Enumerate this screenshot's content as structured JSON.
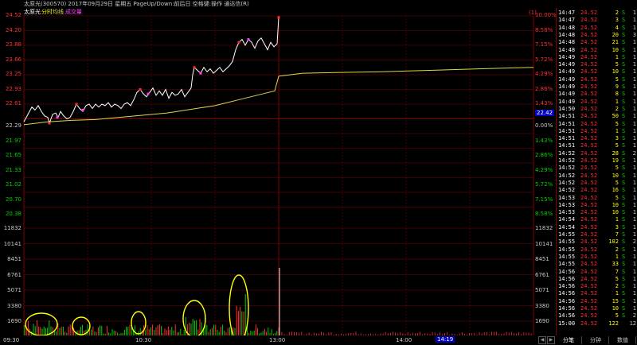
{
  "title": "太原光(300570) 2017年09月29日 星期五 PageUp/Down:前后日 空格键:操作 通达信(R)",
  "tabs": [
    "太原光",
    "分时",
    "均线",
    "成交量"
  ],
  "corner_label": "(1)",
  "colors": {
    "up": "#ff3030",
    "down": "#00d000",
    "grid": "#800000",
    "price_line": "#ffffff",
    "avg_line": "#d8d850",
    "highlight": "#ffff00",
    "marker": "#ff40ff",
    "neutral": "#c8c8c8"
  },
  "price_axis": {
    "left_up": [
      "24.52",
      "24.20",
      "23.88",
      "23.66",
      "23.25",
      "22.93",
      "22.61"
    ],
    "base": "22.29",
    "left_down": [
      "21.97",
      "21.65",
      "21.33",
      "21.02",
      "20.70",
      "20.38"
    ],
    "right_up": [
      "10.00%",
      "8.58%",
      "7.15%",
      "5.72%",
      "4.29%",
      "2.86%",
      "1.43%"
    ],
    "base_pct": "0.00%",
    "right_down": [
      "1.43%",
      "2.86%",
      "4.29%",
      "5.72%",
      "7.15%",
      "8.58%"
    ],
    "current_price_tag": "22.42"
  },
  "volume_axis": [
    "11832",
    "10141",
    "8451",
    "6761",
    "5071",
    "3380",
    "1690"
  ],
  "time_axis": [
    "09:30",
    "10:30",
    "13:00",
    "14:00"
  ],
  "cursor_time": "14:19",
  "ticks": [
    {
      "time": "14:47",
      "price": "24.52",
      "vol": "2",
      "bs": "S",
      "n": "1"
    },
    {
      "time": "14:47",
      "price": "24.52",
      "vol": "3",
      "bs": "S",
      "n": "1"
    },
    {
      "time": "14:48",
      "price": "24.52",
      "vol": "4",
      "bs": "S",
      "n": "1"
    },
    {
      "time": "14:48",
      "price": "24.52",
      "vol": "20",
      "bs": "S",
      "n": "3"
    },
    {
      "time": "14:48",
      "price": "24.52",
      "vol": "21",
      "bs": "S",
      "n": "1"
    },
    {
      "time": "14:48",
      "price": "24.52",
      "vol": "10",
      "bs": "S",
      "n": "1"
    },
    {
      "time": "14:49",
      "price": "24.52",
      "vol": "1",
      "bs": "S",
      "n": "1"
    },
    {
      "time": "14:49",
      "price": "24.52",
      "vol": "5",
      "bs": "S",
      "n": "1"
    },
    {
      "time": "14:49",
      "price": "24.52",
      "vol": "10",
      "bs": "S",
      "n": "1"
    },
    {
      "time": "14:49",
      "price": "24.52",
      "vol": "5",
      "bs": "S",
      "n": "1"
    },
    {
      "time": "14:49",
      "price": "24.52",
      "vol": "9",
      "bs": "S",
      "n": "1"
    },
    {
      "time": "14:49",
      "price": "24.52",
      "vol": "8",
      "bs": "S",
      "n": "1"
    },
    {
      "time": "14:49",
      "price": "24.52",
      "vol": "1",
      "bs": "S",
      "n": "1"
    },
    {
      "time": "14:50",
      "price": "24.52",
      "vol": "2",
      "bs": "S",
      "n": "1"
    },
    {
      "time": "14:51",
      "price": "24.52",
      "vol": "50",
      "bs": "S",
      "n": "1"
    },
    {
      "time": "14:51",
      "price": "24.52",
      "vol": "5",
      "bs": "S",
      "n": "1"
    },
    {
      "time": "14:51",
      "price": "24.52",
      "vol": "1",
      "bs": "S",
      "n": "1"
    },
    {
      "time": "14:51",
      "price": "24.52",
      "vol": "3",
      "bs": "S",
      "n": "1"
    },
    {
      "time": "14:51",
      "price": "24.52",
      "vol": "5",
      "bs": "S",
      "n": "1"
    },
    {
      "time": "14:52",
      "price": "24.52",
      "vol": "28",
      "bs": "S",
      "n": "2"
    },
    {
      "time": "14:52",
      "price": "24.52",
      "vol": "19",
      "bs": "S",
      "n": "1"
    },
    {
      "time": "14:52",
      "price": "24.52",
      "vol": "5",
      "bs": "S",
      "n": "1"
    },
    {
      "time": "14:52",
      "price": "24.52",
      "vol": "10",
      "bs": "S",
      "n": "1"
    },
    {
      "time": "14:52",
      "price": "24.52",
      "vol": "5",
      "bs": "S",
      "n": "1"
    },
    {
      "time": "14:52",
      "price": "24.52",
      "vol": "16",
      "bs": "S",
      "n": "1"
    },
    {
      "time": "14:53",
      "price": "24.52",
      "vol": "5",
      "bs": "S",
      "n": "1"
    },
    {
      "time": "14:53",
      "price": "24.52",
      "vol": "10",
      "bs": "S",
      "n": "1"
    },
    {
      "time": "14:53",
      "price": "24.52",
      "vol": "10",
      "bs": "S",
      "n": "1"
    },
    {
      "time": "14:54",
      "price": "24.52",
      "vol": "1",
      "bs": "S",
      "n": "1"
    },
    {
      "time": "14:54",
      "price": "24.52",
      "vol": "3",
      "bs": "S",
      "n": "1"
    },
    {
      "time": "14:55",
      "price": "24.52",
      "vol": "7",
      "bs": "S",
      "n": "1"
    },
    {
      "time": "14:55",
      "price": "24.52",
      "vol": "102",
      "bs": "S",
      "n": "2"
    },
    {
      "time": "14:55",
      "price": "24.52",
      "vol": "2",
      "bs": "S",
      "n": "1"
    },
    {
      "time": "14:55",
      "price": "24.52",
      "vol": "1",
      "bs": "S",
      "n": "1"
    },
    {
      "time": "14:55",
      "price": "24.52",
      "vol": "33",
      "bs": "S",
      "n": "1"
    },
    {
      "time": "14:56",
      "price": "24.52",
      "vol": "7",
      "bs": "S",
      "n": "1"
    },
    {
      "time": "14:56",
      "price": "24.52",
      "vol": "5",
      "bs": "S",
      "n": "1"
    },
    {
      "time": "14:56",
      "price": "24.52",
      "vol": "2",
      "bs": "S",
      "n": "1"
    },
    {
      "time": "14:56",
      "price": "24.52",
      "vol": "1",
      "bs": "S",
      "n": "1"
    },
    {
      "time": "14:56",
      "price": "24.52",
      "vol": "15",
      "bs": "S",
      "n": "1"
    },
    {
      "time": "14:56",
      "price": "24.52",
      "vol": "10",
      "bs": "S",
      "n": "1"
    },
    {
      "time": "14:56",
      "price": "24.52",
      "vol": "5",
      "bs": "S",
      "n": "2"
    },
    {
      "time": "15:00",
      "price": "24.52",
      "vol": "122",
      "bs": "",
      "n": "12"
    }
  ],
  "bottom_tabs": [
    "分笔",
    "分钟",
    "数值"
  ]
}
